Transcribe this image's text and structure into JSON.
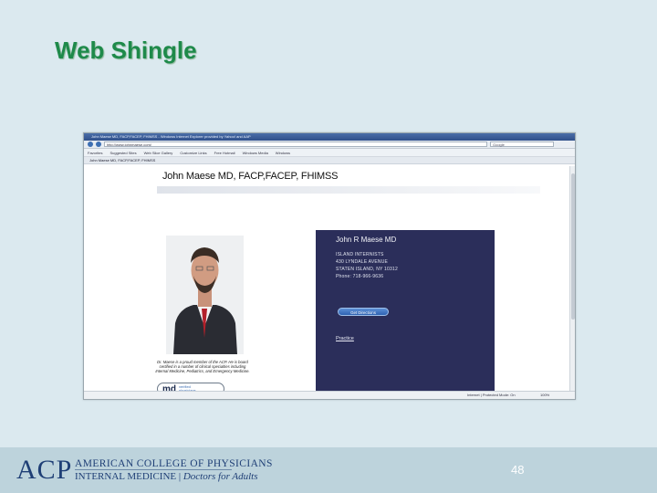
{
  "slide": {
    "title": "Web Shingle",
    "page_number": "48"
  },
  "browser": {
    "window_title": "John Maese MD, FACP,FACEP, FHIMSS - Windows Internet Explorer provided by Yahoo! and AAP",
    "url": "http://www.johnmaese.com/",
    "search_placeholder": "Google",
    "favorites": [
      "Favorites",
      "Suggested Sites",
      "Web Slice Gallery",
      "Customize Links",
      "Free Hotmail",
      "Windows Media",
      "Windows"
    ],
    "tab_label": "John Maese MD, FACP,FACEP, FHIMSS",
    "status_zone": "Internet | Protected Mode: On",
    "status_zoom": "100%"
  },
  "webpage": {
    "heading": "John Maese MD, FACP,FACEP, FHIMSS",
    "caption": "Dr. Maese is a proud member of the ACP. He is board certified in a number of clinical specialties including Internal Medicine, Pediatrics, and Emergency Medicine.",
    "badge": {
      "mark": "md",
      "line1": "verified",
      "line2": "physicians"
    },
    "info_panel": {
      "name": "John R Maese MD",
      "practice_name": "ISLAND INTERNISTS",
      "street": "430 LYNDALE AVENUE",
      "city": "STATEN ISLAND, NY 10312",
      "phone": "Phone: 718-966-9636",
      "directions_button": "Get Directions",
      "practice_link": "Practice"
    },
    "panel_color": "#2b2e5a"
  },
  "footer": {
    "logo_text": "ACP",
    "org_name": "AMERICAN COLLEGE OF PHYSICIANS",
    "tagline_left": "INTERNAL MEDICINE",
    "tagline_right": "Doctors for Adults",
    "brand_color": "#1f3f76"
  }
}
